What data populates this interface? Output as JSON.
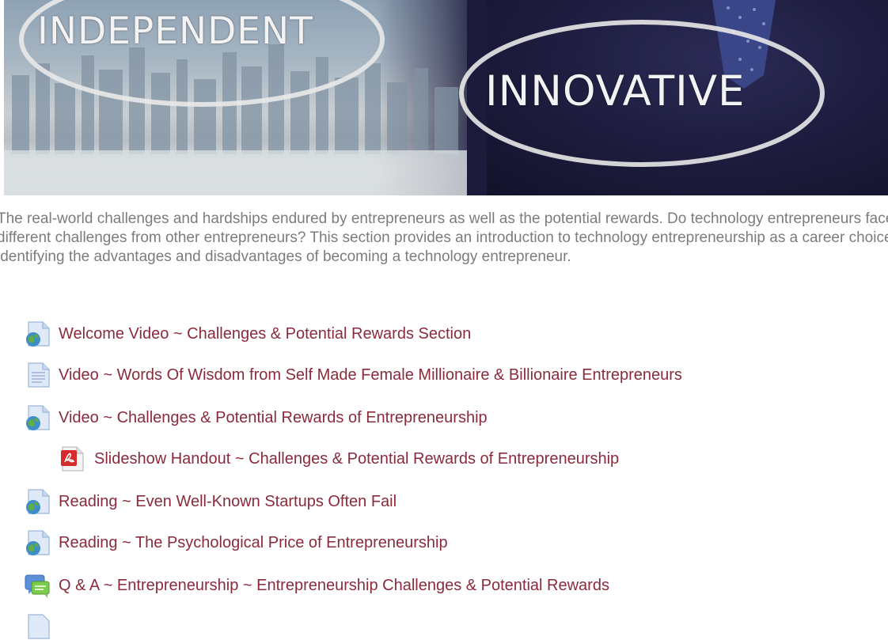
{
  "banner": {
    "word_left": "INDEPENDENT",
    "word_right": "INNOVATIVE"
  },
  "intro": {
    "text": "The real-world challenges and hardships endured by entrepreneurs as well as the potential rewards. Do technology entrepreneurs face different challenges from other entrepreneurs? This section provides an introduction to technology entrepreneurship as a career choice identifying the advantages and disadvantages of becoming a technology entrepreneur."
  },
  "activities": [
    {
      "icon": "url-globe-icon",
      "label": "Welcome Video ~ Challenges & Potential Rewards Section"
    },
    {
      "icon": "page-icon",
      "label": "Video ~ Words Of Wisdom from Self Made Female Millionaire & Billionaire Entrepreneurs"
    },
    {
      "icon": "url-globe-icon",
      "label": "Video ~ Challenges & Potential Rewards of Entrepreneurship"
    },
    {
      "icon": "pdf-icon",
      "label": "Slideshow Handout ~ Challenges & Potential Rewards of Entrepreneurship"
    },
    {
      "icon": "url-globe-icon",
      "label": "Reading ~ Even Well-Known Startups Often Fail"
    },
    {
      "icon": "url-globe-icon",
      "label": "Reading ~ The Psychological Price of Entrepreneurship"
    },
    {
      "icon": "forum-icon",
      "label": "Q & A ~ Entrepreneurship ~ Entrepreneurship Challenges & Potential Rewards"
    }
  ],
  "colors": {
    "link": "#8a2b3c",
    "body_text": "#7c7c7c",
    "banner_dark": "#1c1b3c"
  }
}
